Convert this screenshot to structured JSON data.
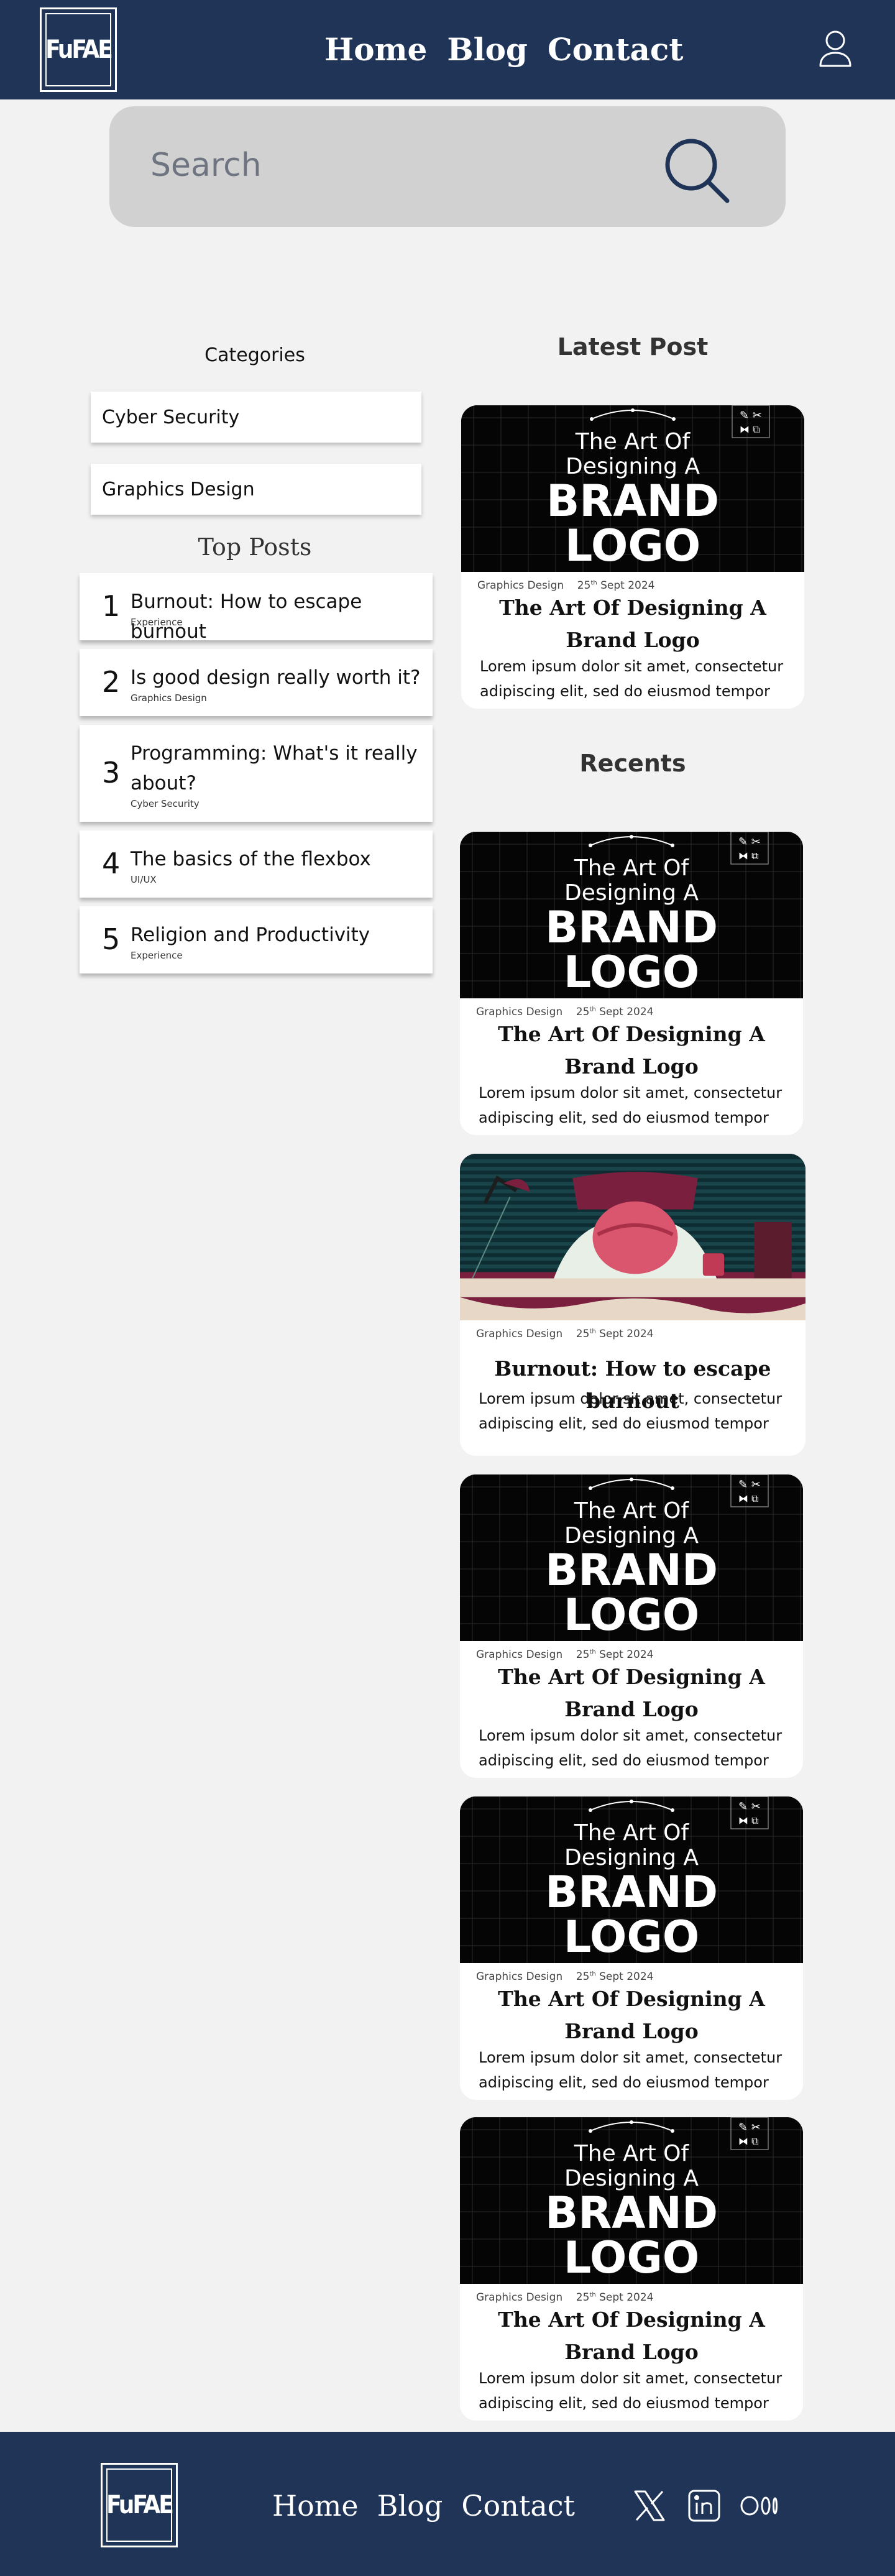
{
  "header": {
    "logo_text": "FuFAE",
    "nav": [
      "Home",
      "Blog",
      "Contact"
    ]
  },
  "search": {
    "placeholder": "Search"
  },
  "categories": {
    "title": "Categories",
    "items": [
      "Cyber Security",
      "Graphics Design"
    ]
  },
  "top_posts": {
    "title": "Top Posts",
    "items": [
      {
        "num": "1",
        "title": "Burnout: How to escape burnout",
        "category": "Experience"
      },
      {
        "num": "2",
        "title": "Is good design really worth it?",
        "category": "Graphics Design"
      },
      {
        "num": "3",
        "title": "Programming: What's it really about?",
        "category": "Cyber Security"
      },
      {
        "num": "4",
        "title": "The basics of the flexbox",
        "category": "UI/UX"
      },
      {
        "num": "5",
        "title": "Religion and Productivity",
        "category": "Experience"
      }
    ]
  },
  "latest": {
    "title": "Latest Post",
    "card": {
      "category": "Graphics Design",
      "date": "25",
      "date_sup": "th",
      "date_rest": " Sept 2024",
      "title": "The Art Of Designing A Brand Logo",
      "excerpt": "Lorem ipsum dolor sit amet, consectetur adipiscing elit, sed do eiusmod tempor"
    }
  },
  "recents": {
    "title": "Recents",
    "cards": [
      {
        "category": "Graphics Design",
        "date": "25",
        "date_sup": "th",
        "date_rest": " Sept 2024",
        "title": "The Art Of Designing A Brand Logo",
        "excerpt": "Lorem ipsum dolor sit amet, consectetur adipiscing elit, sed do eiusmod tempor",
        "image": "brand-logo"
      },
      {
        "category": "Graphics Design",
        "date": "25",
        "date_sup": "th",
        "date_rest": " Sept 2024",
        "title": "Burnout: How to escape burnout",
        "excerpt": "Lorem ipsum dolor sit amet, consectetur adipiscing elit, sed do eiusmod tempor",
        "image": "burnout"
      },
      {
        "category": "Graphics Design",
        "date": "25",
        "date_sup": "th",
        "date_rest": " Sept 2024",
        "title": "The Art Of Designing A Brand Logo",
        "excerpt": "Lorem ipsum dolor sit amet, consectetur adipiscing elit, sed do eiusmod tempor",
        "image": "brand-logo"
      },
      {
        "category": "Graphics Design",
        "date": "25",
        "date_sup": "th",
        "date_rest": " Sept 2024",
        "title": "The Art Of Designing A Brand Logo",
        "excerpt": "Lorem ipsum dolor sit amet, consectetur adipiscing elit, sed do eiusmod tempor",
        "image": "brand-logo"
      },
      {
        "category": "Graphics Design",
        "date": "25",
        "date_sup": "th",
        "date_rest": " Sept 2024",
        "title": "The Art Of Designing A Brand Logo",
        "excerpt": "Lorem ipsum dolor sit amet, consectetur adipiscing elit, sed do eiusmod tempor",
        "image": "brand-logo"
      }
    ]
  },
  "thumb_text": {
    "line1": "The Art Of",
    "line2": "Designing A",
    "line3": "BRAND",
    "line4": "LOGO"
  },
  "footer": {
    "logo_text": "FuFAE",
    "nav": [
      "Home",
      "Blog",
      "Contact"
    ],
    "social_icons": [
      "x-icon",
      "linkedin-icon",
      "medium-icon"
    ]
  },
  "colors": {
    "navy": "#1f3457",
    "background": "#f2f2f2",
    "search": "#d1d1d1"
  }
}
